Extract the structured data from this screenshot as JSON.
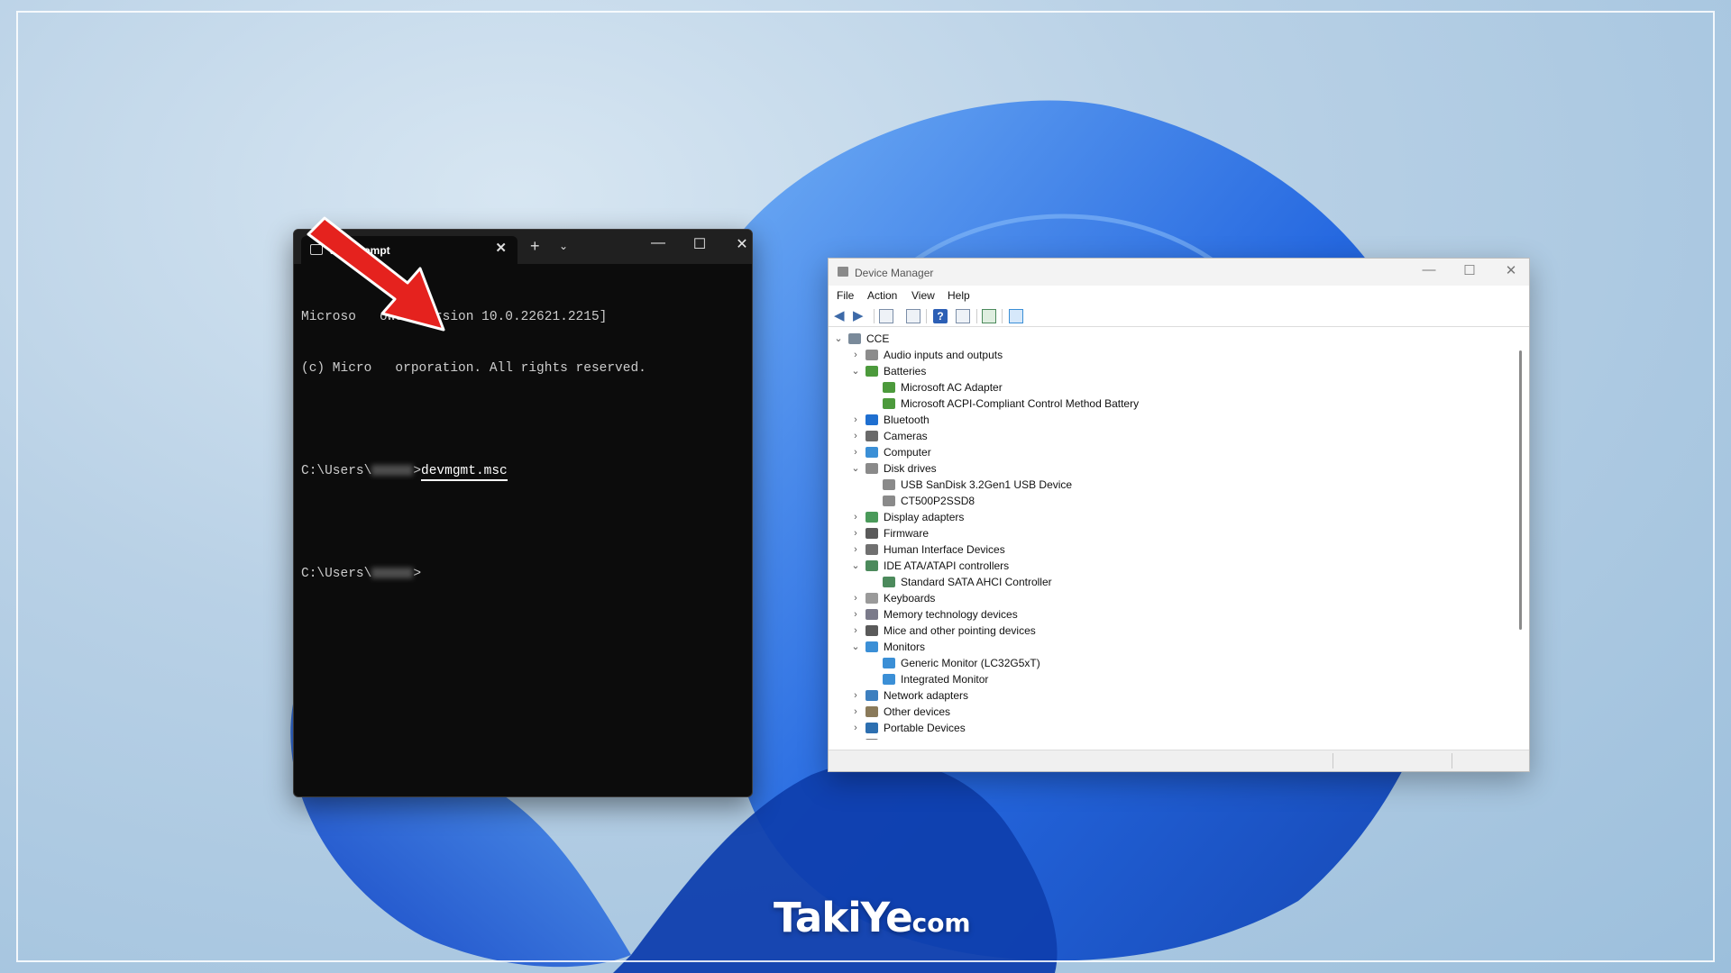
{
  "cmd": {
    "tab_title": "and Prompt",
    "lines": [
      "Microso   ows [Version 10.0.22621.2215]",
      "(c) Micro   orporation. All rights reserved."
    ],
    "prompt1_prefix": "C:\\Users\\",
    "prompt1_suffix": ">",
    "command": "devmgmt.msc",
    "prompt2_prefix": "C:\\Users\\",
    "prompt2_suffix": ">",
    "controls": {
      "new_tab": "+",
      "dropdown": "⌄",
      "minimize": "—",
      "maximize": "☐",
      "close": "✕"
    }
  },
  "device_manager": {
    "title": "Device Manager",
    "menu": [
      "File",
      "Action",
      "View",
      "Help"
    ],
    "tree": [
      {
        "label": "CCE",
        "level": 0,
        "state": "expanded",
        "icon": "computer-icon"
      },
      {
        "label": "Audio inputs and outputs",
        "level": 1,
        "state": "collapsed",
        "icon": "speaker-icon"
      },
      {
        "label": "Batteries",
        "level": 1,
        "state": "expanded",
        "icon": "battery-icon"
      },
      {
        "label": "Microsoft AC Adapter",
        "level": 2,
        "state": "leaf",
        "icon": "battery-icon"
      },
      {
        "label": "Microsoft ACPI-Compliant Control Method Battery",
        "level": 2,
        "state": "leaf",
        "icon": "battery-icon"
      },
      {
        "label": "Bluetooth",
        "level": 1,
        "state": "collapsed",
        "icon": "bluetooth-icon"
      },
      {
        "label": "Cameras",
        "level": 1,
        "state": "collapsed",
        "icon": "camera-icon"
      },
      {
        "label": "Computer",
        "level": 1,
        "state": "collapsed",
        "icon": "monitor-icon"
      },
      {
        "label": "Disk drives",
        "level": 1,
        "state": "expanded",
        "icon": "disk-icon"
      },
      {
        "label": "USB  SanDisk 3.2Gen1 USB Device",
        "level": 2,
        "state": "leaf",
        "icon": "disk-icon"
      },
      {
        "label": "CT500P2SSD8",
        "level": 2,
        "state": "leaf",
        "icon": "disk-icon"
      },
      {
        "label": "Display adapters",
        "level": 1,
        "state": "collapsed",
        "icon": "display-adapter-icon"
      },
      {
        "label": "Firmware",
        "level": 1,
        "state": "collapsed",
        "icon": "firmware-icon"
      },
      {
        "label": "Human Interface Devices",
        "level": 1,
        "state": "collapsed",
        "icon": "hid-icon"
      },
      {
        "label": "IDE ATA/ATAPI controllers",
        "level": 1,
        "state": "expanded",
        "icon": "controller-icon"
      },
      {
        "label": "Standard SATA AHCI Controller",
        "level": 2,
        "state": "leaf",
        "icon": "controller-icon"
      },
      {
        "label": "Keyboards",
        "level": 1,
        "state": "collapsed",
        "icon": "keyboard-icon"
      },
      {
        "label": "Memory technology devices",
        "level": 1,
        "state": "collapsed",
        "icon": "memory-icon"
      },
      {
        "label": "Mice and other pointing devices",
        "level": 1,
        "state": "collapsed",
        "icon": "mouse-icon"
      },
      {
        "label": "Monitors",
        "level": 1,
        "state": "expanded",
        "icon": "monitor-icon"
      },
      {
        "label": "Generic Monitor (LC32G5xT)",
        "level": 2,
        "state": "leaf",
        "icon": "monitor-icon"
      },
      {
        "label": "Integrated Monitor",
        "level": 2,
        "state": "leaf",
        "icon": "monitor-icon"
      },
      {
        "label": "Network adapters",
        "level": 1,
        "state": "collapsed",
        "icon": "network-icon"
      },
      {
        "label": "Other devices",
        "level": 1,
        "state": "collapsed",
        "icon": "unknown-device-icon"
      },
      {
        "label": "Portable Devices",
        "level": 1,
        "state": "collapsed",
        "icon": "portable-device-icon"
      },
      {
        "label": "Ports (COM & LPT)",
        "level": 1,
        "state": "collapsed",
        "icon": "port-icon"
      }
    ],
    "icon_colors": {
      "computer-icon": "#7a8a9a",
      "speaker-icon": "#8c8c8c",
      "battery-icon": "#4c9a3c",
      "bluetooth-icon": "#1f6fd0",
      "camera-icon": "#6a6a6a",
      "monitor-icon": "#3b8fd6",
      "disk-icon": "#8a8a8a",
      "display-adapter-icon": "#4a9a5a",
      "firmware-icon": "#5a5a5a",
      "hid-icon": "#707070",
      "controller-icon": "#4c8a5c",
      "keyboard-icon": "#9a9a9a",
      "memory-icon": "#7a7a8a",
      "mouse-icon": "#5a5a5a",
      "network-icon": "#3d7fbf",
      "unknown-device-icon": "#8a7a5a",
      "portable-device-icon": "#2d6fb0",
      "port-icon": "#7a7a7a"
    }
  },
  "logo": {
    "main": "TakiYe",
    "suffix": "com"
  },
  "colors": {
    "accent_arrow": "#e5221e",
    "wallpaper_blue": "#1f5fd6"
  }
}
